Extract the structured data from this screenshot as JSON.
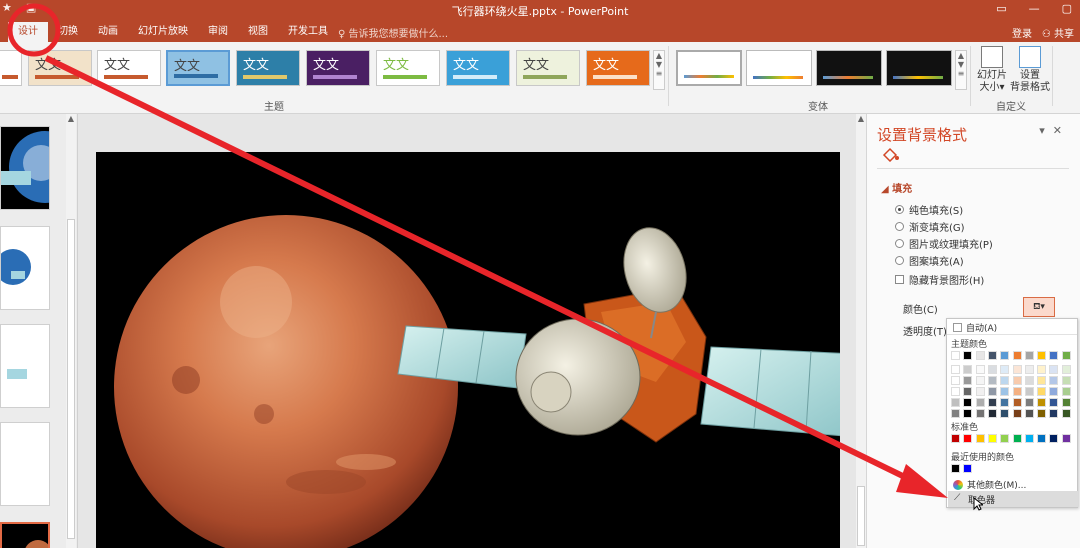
{
  "window": {
    "title": "飞行器环绕火星.pptx - PowerPoint",
    "controls": [
      "▭",
      "—",
      "▢"
    ]
  },
  "tabs": [
    "设计",
    "切换",
    "动画",
    "幻灯片放映",
    "审阅",
    "视图",
    "开发工具"
  ],
  "tell_me": "♀ 告诉我您想要做什么...",
  "account": {
    "login": "登录",
    "share": "共享"
  },
  "ribbon": {
    "themes_label": "主题",
    "variants_label": "变体",
    "custom_label": "自定义",
    "theme_text": "文文",
    "slide_size": "幻灯片\n大小▾",
    "format_bg": "设置\n背景格式"
  },
  "theme_colors": [
    "#c65a2e",
    "#ffffff",
    "#5b9bd5",
    "#3a8fb7",
    "#6b2c91",
    "#7dbb42",
    "#3aa0d8",
    "#c9d4a8",
    "#e66a1b"
  ],
  "variant_colors": [
    "#ffffff",
    "#ffffff",
    "#111111",
    "#111111"
  ],
  "pane": {
    "title": "设置背景格式",
    "fill_section": "填充",
    "options": [
      "纯色填充(S)",
      "渐变填充(G)",
      "图片或纹理填充(P)",
      "图案填充(A)"
    ],
    "hide_bg": "隐藏背景图形(H)",
    "color_label": "颜色(C)",
    "transparency_label": "透明度(T)"
  },
  "dropdown": {
    "auto": "自动(A)",
    "theme_colors_head": "主题颜色",
    "standard_head": "标准色",
    "recent_head": "最近使用的颜色",
    "more_colors": "其他颜色(M)...",
    "eyedropper": "取色器",
    "theme_row": [
      "#ffffff",
      "#000000",
      "#e7e6e6",
      "#44546a",
      "#5b9bd5",
      "#ed7d31",
      "#a5a5a5",
      "#ffc000",
      "#4472c4",
      "#70ad47"
    ],
    "standard_row": [
      "#c00000",
      "#ff0000",
      "#ffc000",
      "#ffff00",
      "#92d050",
      "#00b050",
      "#00b0f0",
      "#0070c0",
      "#002060",
      "#7030a0"
    ],
    "recent_row": [
      "#000000",
      "#0000ff"
    ]
  },
  "annotation_color": "#e8252a"
}
